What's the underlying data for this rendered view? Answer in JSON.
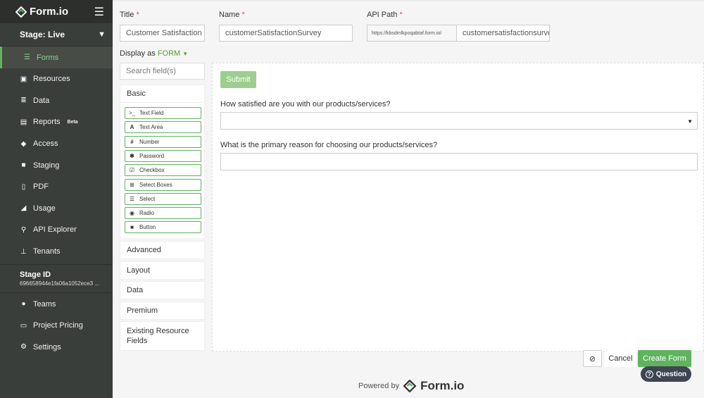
{
  "brand": {
    "name": "Form.io"
  },
  "sidebar": {
    "stage": "Stage: Live",
    "items": [
      {
        "label": "Forms",
        "icon": "forms-icon"
      },
      {
        "label": "Resources",
        "icon": "resources-icon"
      },
      {
        "label": "Data",
        "icon": "database-icon"
      },
      {
        "label": "Reports",
        "icon": "reports-icon",
        "badge": "Beta"
      },
      {
        "label": "Access",
        "icon": "shield-icon"
      },
      {
        "label": "Staging",
        "icon": "folder-icon"
      },
      {
        "label": "PDF",
        "icon": "pdf-icon"
      },
      {
        "label": "Usage",
        "icon": "chart-icon"
      },
      {
        "label": "API Explorer",
        "icon": "pin-icon"
      },
      {
        "label": "Tenants",
        "icon": "sitemap-icon"
      }
    ],
    "stage_id_title": "Stage ID",
    "stage_id_value": "696658944e1fa06a1052ece3 ...",
    "bottom_items": [
      {
        "label": "Teams",
        "icon": "users-icon"
      },
      {
        "label": "Project Pricing",
        "icon": "card-icon"
      },
      {
        "label": "Settings",
        "icon": "gear-icon"
      }
    ]
  },
  "form_fields": {
    "title_label": "Title",
    "title_value": "Customer Satisfaction Survey",
    "name_label": "Name",
    "name_value": "customerSatisfactionSurvey",
    "api_label": "API Path",
    "api_prefix": "https://kbsdmlkpoqabtaf.form.io/",
    "api_value": "customersatisfactionsurvey",
    "required_mark": "*"
  },
  "display_as": {
    "label": "Display as",
    "value": "FORM"
  },
  "palette": {
    "search_placeholder": "Search field(s)",
    "basic_label": "Basic",
    "components": [
      {
        "label": "Text Field",
        "icon": "terminal-icon"
      },
      {
        "label": "Text Area",
        "icon": "font-icon"
      },
      {
        "label": "Number",
        "icon": "hash-icon"
      },
      {
        "label": "Password",
        "icon": "asterisk-icon"
      },
      {
        "label": "Checkbox",
        "icon": "checkbox-icon"
      },
      {
        "label": "Select Boxes",
        "icon": "plus-square-icon"
      },
      {
        "label": "Select",
        "icon": "list-icon"
      },
      {
        "label": "Radio",
        "icon": "radio-icon"
      },
      {
        "label": "Button",
        "icon": "stop-icon"
      }
    ],
    "groups": [
      "Advanced",
      "Layout",
      "Data",
      "Premium",
      "Existing Resource Fields"
    ]
  },
  "canvas": {
    "submit_label": "Submit",
    "q1": "How satisfied are you with our products/services?",
    "q2": "What is the primary reason for choosing our products/services?"
  },
  "actions": {
    "cancel": "Cancel",
    "create": "Create Form",
    "question": "Question"
  },
  "footer": {
    "powered_by": "Powered by",
    "logo_text": "Form.io"
  },
  "colors": {
    "accent": "#5fb35f",
    "sidebar": "#3a3e3a",
    "required": "#d9534f"
  }
}
